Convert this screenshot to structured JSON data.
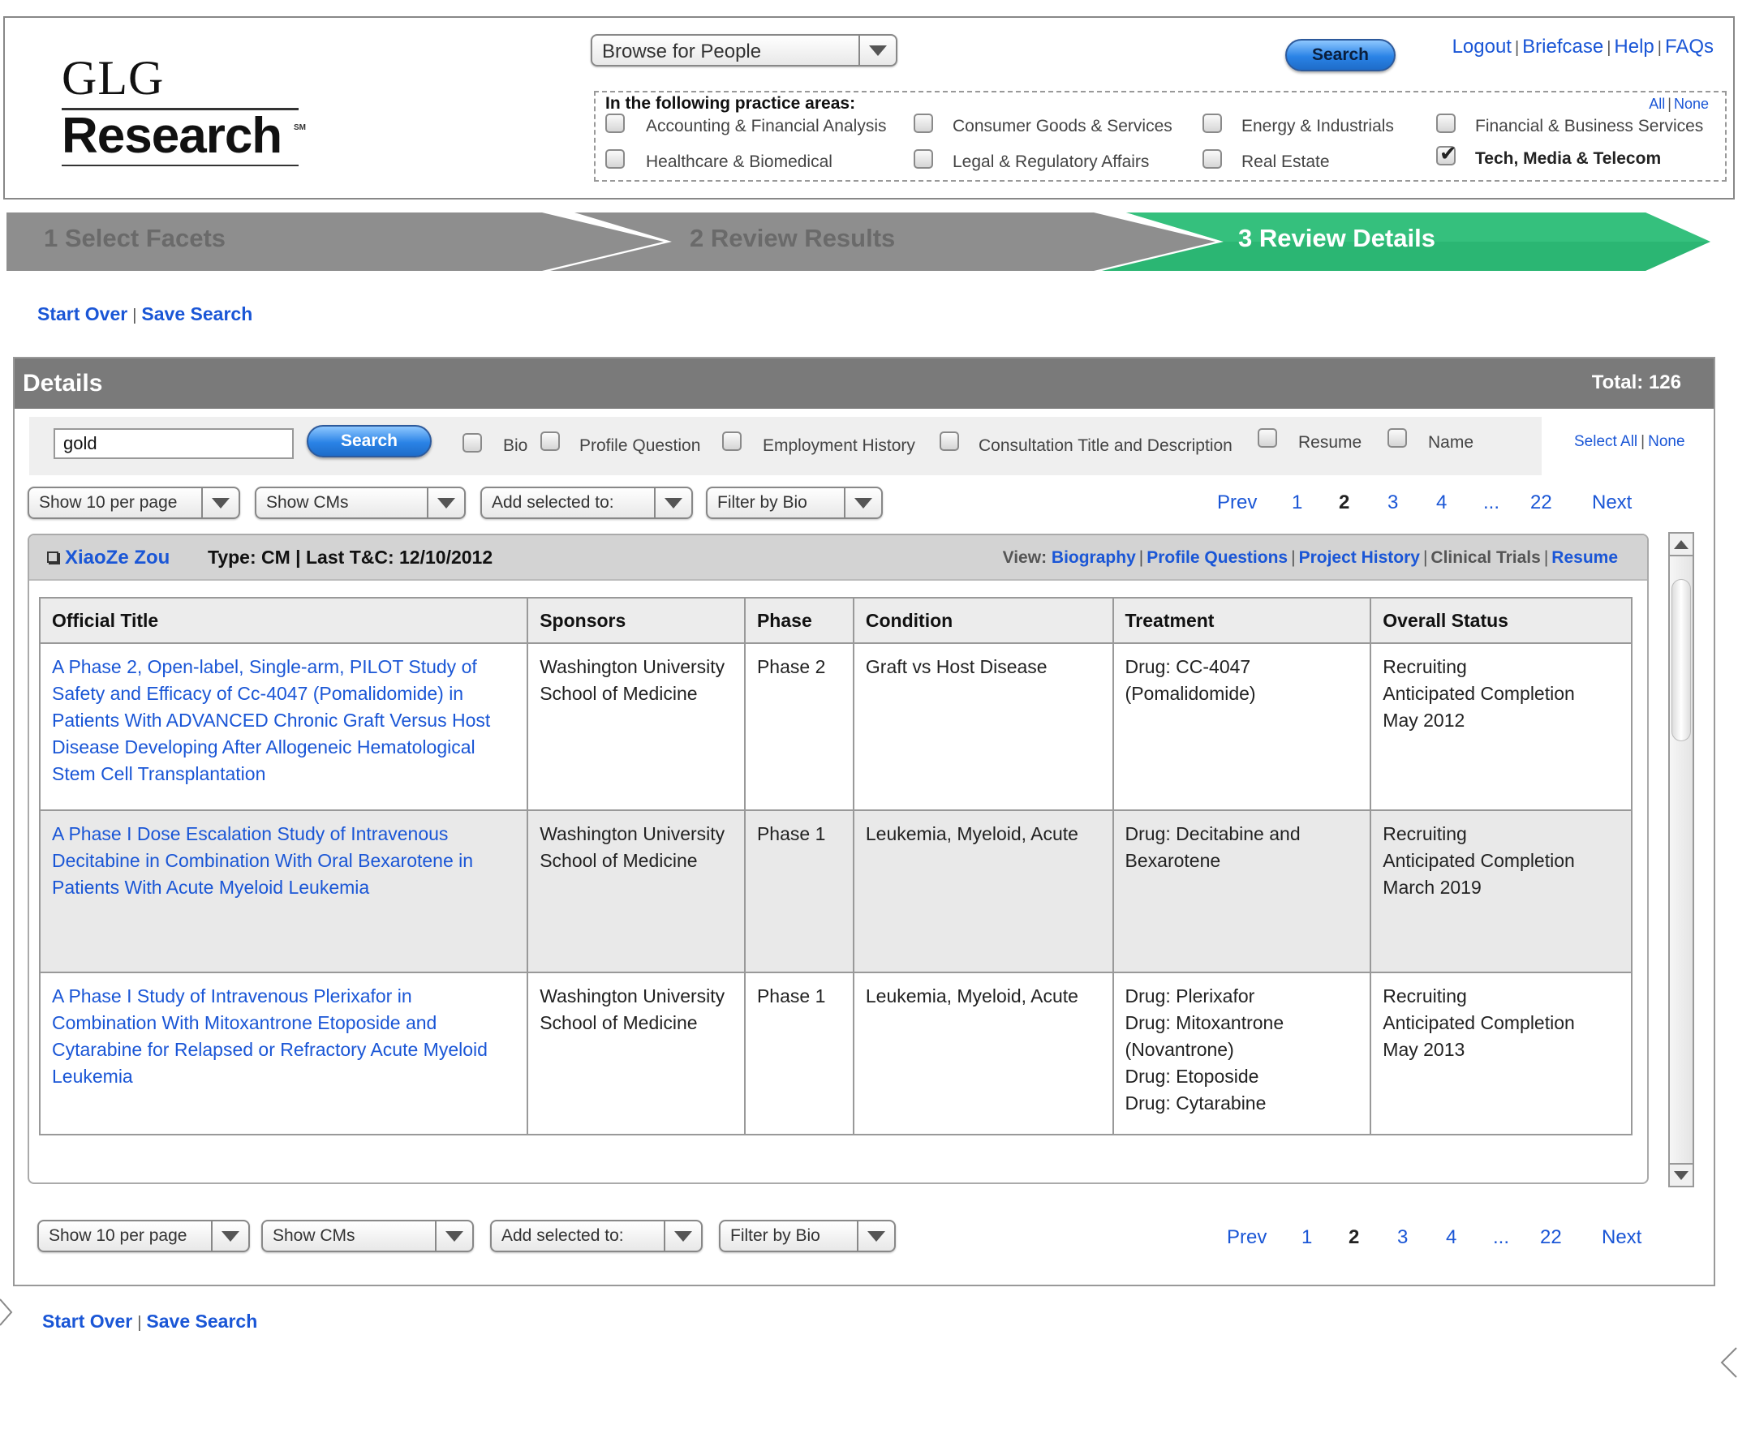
{
  "logo": {
    "line1": "GLG",
    "line2": "Research",
    "mark": "SM"
  },
  "header": {
    "browse_select": "Browse for People",
    "search_button": "Search",
    "links": [
      "Logout",
      "Briefcase",
      "Help",
      "FAQs"
    ],
    "practice": {
      "title": "In the following practice areas:",
      "all": "All",
      "none": "None",
      "areas": [
        {
          "label": "Accounting & Financial Analysis",
          "checked": false
        },
        {
          "label": "Consumer Goods & Services",
          "checked": false
        },
        {
          "label": "Energy & Industrials",
          "checked": false
        },
        {
          "label": "Financial & Business Services",
          "checked": false
        },
        {
          "label": "Healthcare & Biomedical",
          "checked": false
        },
        {
          "label": "Legal & Regulatory Affairs",
          "checked": false
        },
        {
          "label": "Real Estate",
          "checked": false
        },
        {
          "label": "Tech, Media & Telecom",
          "checked": true
        }
      ]
    }
  },
  "steps": [
    {
      "label": "1 Select Facets",
      "active": false
    },
    {
      "label": "2 Review Results",
      "active": false
    },
    {
      "label": "3 Review Details",
      "active": true
    }
  ],
  "actions": {
    "start_over": "Start Over",
    "save_search": "Save Search"
  },
  "details": {
    "title": "Details",
    "total": "Total: 126",
    "search_value": "gold",
    "search_button": "Search",
    "fields": [
      "Bio",
      "Profile Question",
      "Employment History",
      "Consultation Title and Description",
      "Resume",
      "Name"
    ],
    "select_all": "Select All",
    "select_none": "None",
    "controls": {
      "per_page": "Show 10 per page",
      "show": "Show CMs",
      "add_to": "Add selected to:",
      "filter": "Filter by Bio"
    },
    "pager": {
      "prev": "Prev",
      "pages": [
        "1",
        "2",
        "3",
        "4",
        "...",
        "22"
      ],
      "current": "2",
      "next": "Next"
    }
  },
  "card": {
    "name": "XiaoZe Zou",
    "meta": "Type: CM | Last T&C: 12/10/2012",
    "view_label": "View:",
    "views": [
      {
        "label": "Biography",
        "link": true
      },
      {
        "label": "Profile Questions",
        "link": true
      },
      {
        "label": "Project History",
        "link": true
      },
      {
        "label": "Clinical Trials",
        "link": false
      },
      {
        "label": "Resume",
        "link": true
      }
    ],
    "columns": [
      "Official Title",
      "Sponsors",
      "Phase",
      "Condition",
      "Treatment",
      "Overall Status"
    ],
    "rows": [
      {
        "title": "A Phase 2, Open-label, Single-arm, PILOT Study of Safety and Efficacy of Cc-4047 (Pomalidomide) in Patients With ADVANCED Chronic Graft Versus Host Disease Developing After Allogeneic Hematological Stem Cell Transplantation",
        "sponsor": "Washington University School of Medicine",
        "phase": "Phase 2",
        "condition": "Graft vs Host Disease",
        "treatment": [
          "Drug: CC-4047",
          "(Pomalidomide)"
        ],
        "status": [
          "Recruiting",
          "Anticipated Completion",
          "May 2012"
        ]
      },
      {
        "title": "A Phase I Dose Escalation Study of Intravenous Decitabine in Combination With Oral Bexarotene in Patients With Acute Myeloid Leukemia",
        "sponsor": "Washington University School of Medicine",
        "phase": "Phase 1",
        "condition": "Leukemia, Myeloid, Acute",
        "treatment": [
          "Drug: Decitabine and",
          "Bexarotene"
        ],
        "status": [
          "Recruiting",
          "Anticipated Completion",
          "March 2019"
        ]
      },
      {
        "title": "A Phase I Study of Intravenous Plerixafor in Combination With Mitoxantrone Etoposide and Cytarabine for Relapsed or Refractory Acute Myeloid Leukemia",
        "sponsor": "Washington University School of Medicine",
        "phase": "Phase 1",
        "condition": "Leukemia, Myeloid, Acute",
        "treatment": [
          "Drug: Plerixafor",
          "Drug: Mitoxantrone",
          "(Novantrone)",
          "Drug: Etoposide",
          "Drug: Cytarabine"
        ],
        "status": [
          "Recruiting",
          "Anticipated Completion",
          "May 2013"
        ]
      }
    ]
  },
  "colors": {
    "link": "#1a56d6",
    "active_step": "#2bb673",
    "inactive_step": "#8e8e8e",
    "details_bar": "#7a7a7a"
  }
}
